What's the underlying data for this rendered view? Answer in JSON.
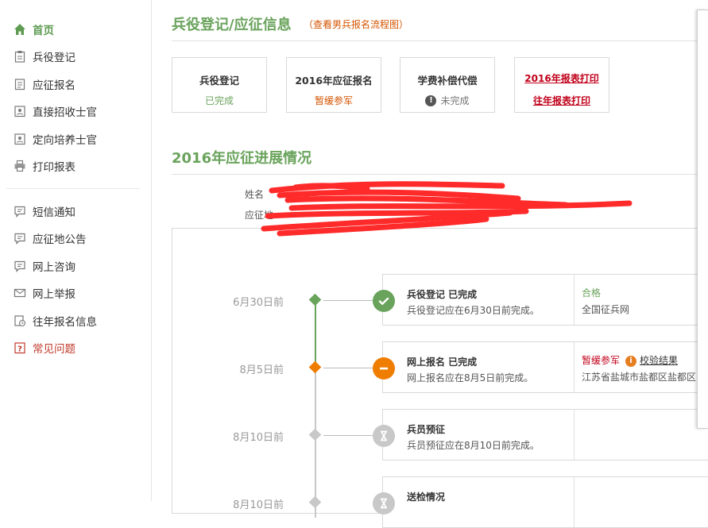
{
  "sidebar": {
    "items": [
      {
        "label": "首页",
        "icon": "home-icon"
      },
      {
        "label": "兵役登记",
        "icon": "clipboard-icon"
      },
      {
        "label": "应征报名",
        "icon": "form-icon"
      },
      {
        "label": "直接招收士官",
        "icon": "id-card-icon"
      },
      {
        "label": "定向培养士官",
        "icon": "id-card-icon"
      },
      {
        "label": "打印报表",
        "icon": "printer-icon"
      },
      {
        "label": "短信通知",
        "icon": "chat-icon"
      },
      {
        "label": "应征地公告",
        "icon": "chat-icon"
      },
      {
        "label": "网上咨询",
        "icon": "chat-icon"
      },
      {
        "label": "网上举报",
        "icon": "mail-icon"
      },
      {
        "label": "往年报名信息",
        "icon": "history-icon"
      },
      {
        "label": "常见问题",
        "icon": "question-icon"
      }
    ]
  },
  "header": {
    "title": "兵役登记/应征信息",
    "flow_link": "（查看男兵报名流程图）"
  },
  "cards": [
    {
      "title": "兵役登记",
      "status": "已完成"
    },
    {
      "title": "2016年应征报名",
      "status": "暂缓参军"
    },
    {
      "title": "学费补偿代偿",
      "status": "未完成"
    },
    {
      "link1": "2016年报表打印",
      "link2": "往年报表打印"
    }
  ],
  "progress": {
    "title": "2016年应征进展情况",
    "info_line1": "姓名",
    "info_line2": "应征地"
  },
  "steps": [
    {
      "date": "6月30日前",
      "name": "兵役登记 已完成",
      "desc": "兵役登记应在6月30日前完成。",
      "result": "合格",
      "org": "全国征兵网"
    },
    {
      "date": "8月5日前",
      "name": "网上报名 已完成",
      "desc": "网上报名应在8月5日前完成。",
      "result": "暂缓参军",
      "verify": "校验结果",
      "org": "江苏省盐城市盐都区盐都区..."
    },
    {
      "date": "8月10日前",
      "name": "兵员预征",
      "desc": "兵员预征应在8月10日前完成。"
    },
    {
      "date": "8月10日前",
      "name": "送检情况"
    }
  ],
  "colors": {
    "green": "#6aa35c",
    "orange": "#ef7d00",
    "gray": "#c8c8c8",
    "red": "#c0001a"
  }
}
